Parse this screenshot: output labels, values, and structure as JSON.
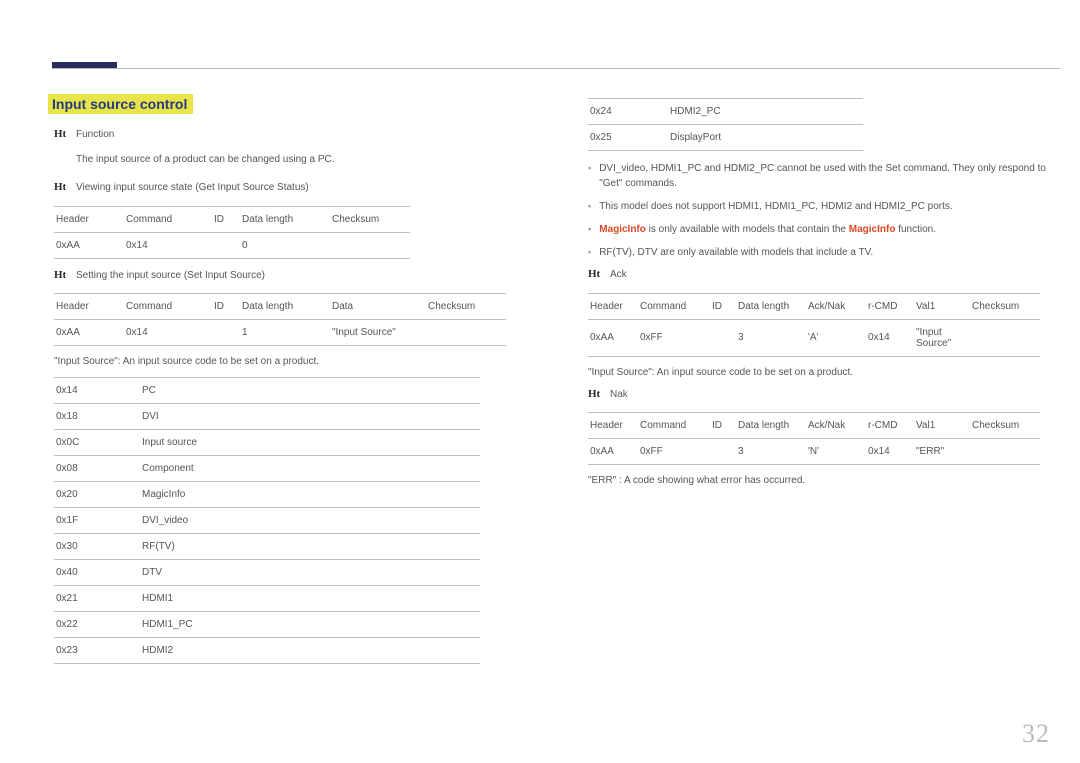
{
  "page_number": "32",
  "ht_glyph": "Ht",
  "heading": "Input source control",
  "left": {
    "function_label": "Function",
    "function_text": "The input source of a product can be changed using a PC.",
    "view_label": "Viewing input source state (Get Input Source Status)",
    "table1": {
      "headers": [
        "Header",
        "Command",
        "ID",
        "Data length",
        "Checksum"
      ],
      "row": [
        "0xAA",
        "0x14",
        "",
        "0",
        ""
      ]
    },
    "set_label": "Setting the input source (Set Input Source)",
    "table2": {
      "headers": [
        "Header",
        "Command",
        "ID",
        "Data length",
        "Data",
        "Checksum"
      ],
      "row": [
        "0xAA",
        "0x14",
        "",
        "1",
        "\"Input Source\"",
        ""
      ]
    },
    "desc1": "\"Input Source\": An input source code to be set on a product.",
    "table3": [
      [
        "0x14",
        "PC"
      ],
      [
        "0x18",
        "DVI"
      ],
      [
        "0x0C",
        "Input source"
      ],
      [
        "0x08",
        "Component"
      ],
      [
        "0x20",
        "MagicInfo"
      ],
      [
        "0x1F",
        "DVI_video"
      ],
      [
        "0x30",
        "RF(TV)"
      ],
      [
        "0x40",
        "DTV"
      ],
      [
        "0x21",
        "HDMI1"
      ],
      [
        "0x22",
        "HDMI1_PC"
      ],
      [
        "0x23",
        "HDMI2"
      ]
    ]
  },
  "right": {
    "table3_cont": [
      [
        "0x24",
        "HDMI2_PC"
      ],
      [
        "0x25",
        "DisplayPort"
      ]
    ],
    "notes": {
      "n1": "DVI_video, HDMI1_PC and HDMI2_PC cannot be used with the Set command. They only respond to \"Get\" commands.",
      "n2": "This model does not support HDMI1, HDMI1_PC, HDMI2 and HDMI2_PC ports.",
      "n3_pre": "",
      "n3_mid": " is only available with models that contain the ",
      "n3_suf": " function.",
      "magic": "MagicInfo",
      "n4": "RF(TV), DTV are only available with models that include a TV."
    },
    "ack_label": "Ack",
    "table_ack": {
      "headers": [
        "Header",
        "Command",
        "ID",
        "Data length",
        "Ack/Nak",
        "r-CMD",
        "Val1",
        "Checksum"
      ],
      "row": [
        "0xAA",
        "0xFF",
        "",
        "3",
        "'A'",
        "0x14",
        "\"Input Source\"",
        ""
      ]
    },
    "desc_ack": "\"Input Source\": An input source code to be set on a product.",
    "nak_label": "Nak",
    "table_nak": {
      "headers": [
        "Header",
        "Command",
        "ID",
        "Data length",
        "Ack/Nak",
        "r-CMD",
        "Val1",
        "Checksum"
      ],
      "row": [
        "0xAA",
        "0xFF",
        "",
        "3",
        "'N'",
        "0x14",
        "\"ERR\"",
        ""
      ]
    },
    "desc_nak": "\"ERR\" : A code showing what error has occurred."
  }
}
